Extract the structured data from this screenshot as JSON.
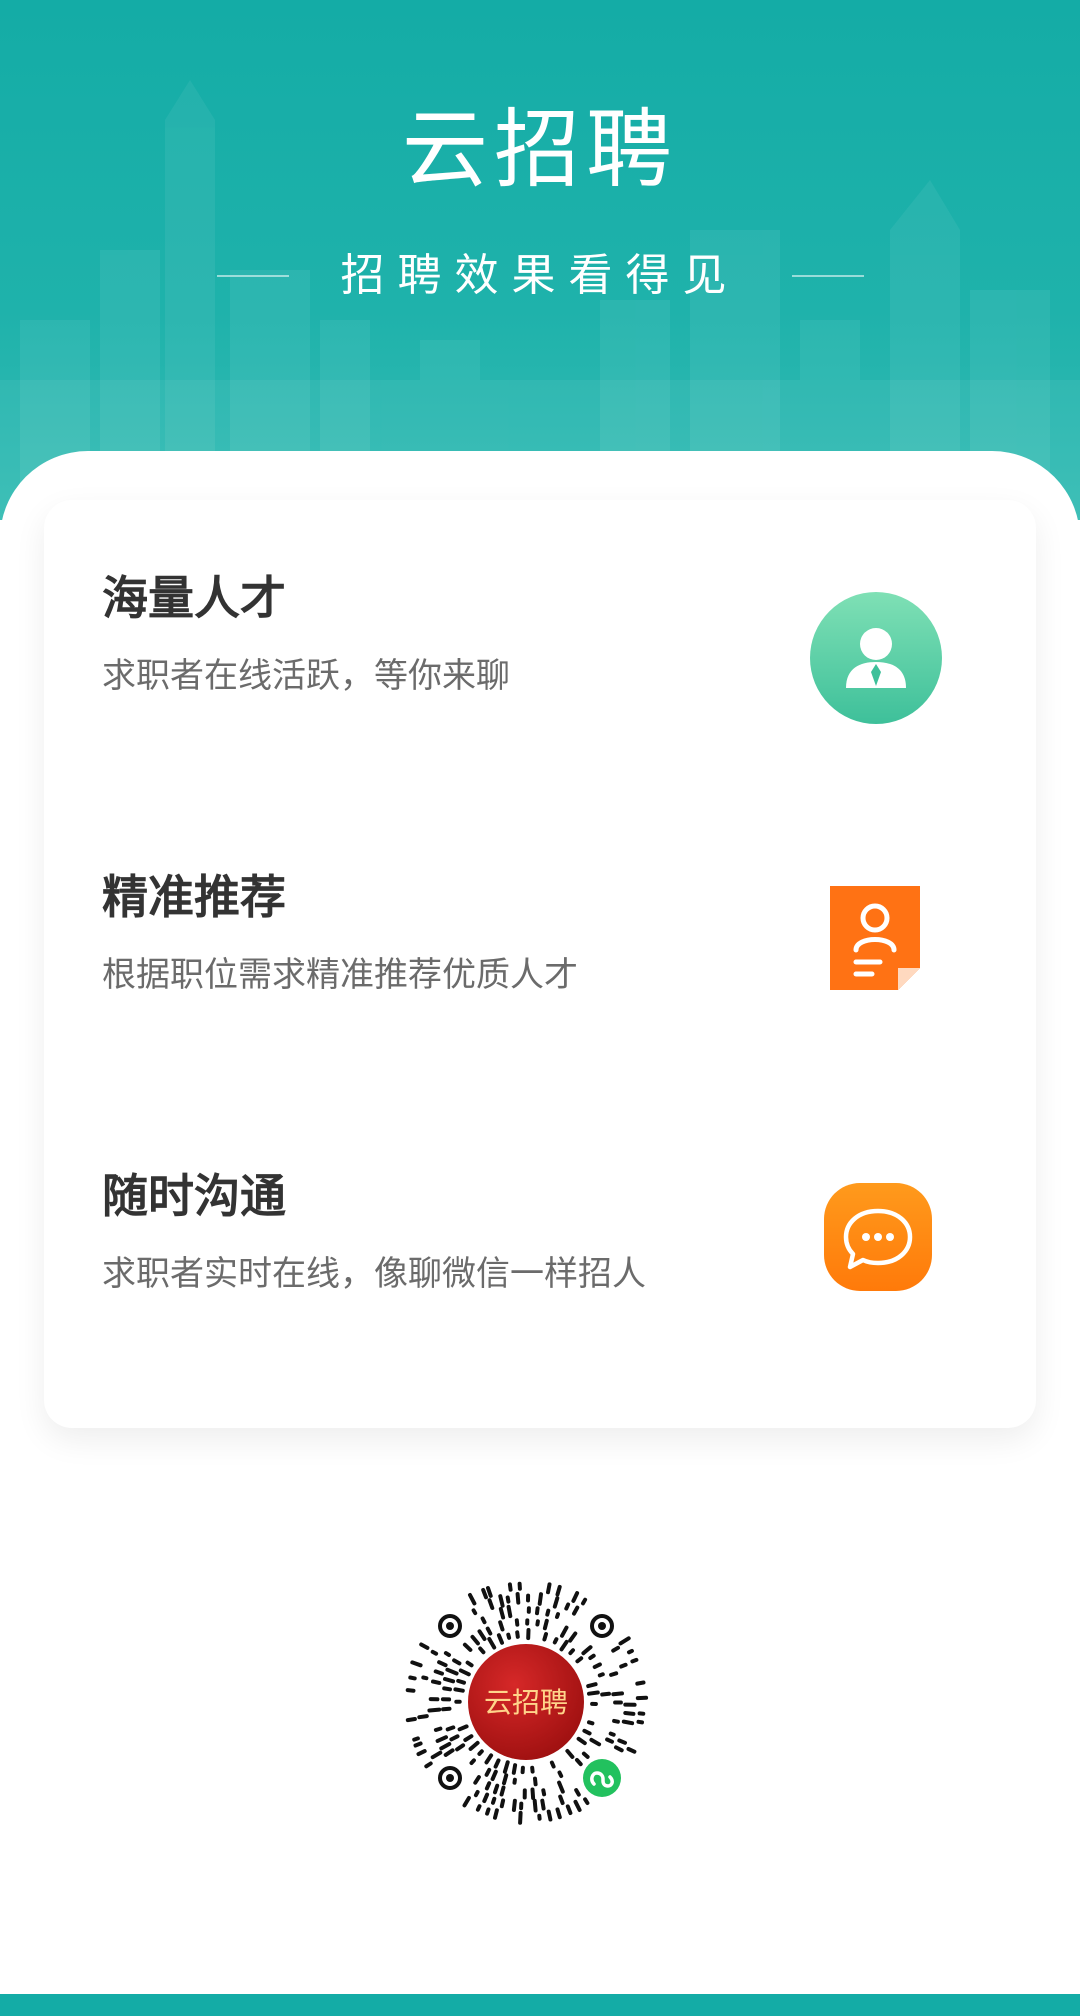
{
  "header": {
    "logo_text": "云招聘",
    "slogan": "招聘效果看得见"
  },
  "features": [
    {
      "title": "海量人才",
      "description": "求职者在线活跃，等你来聊",
      "icon": "talent-user-icon",
      "icon_color": "#52c9a0"
    },
    {
      "title": "精准推荐",
      "description": "根据职位需求精准推荐优质人才",
      "icon": "resume-document-icon",
      "icon_color": "#ff7a12"
    },
    {
      "title": "随时沟通",
      "description": "求职者实时在线，像聊微信一样招人",
      "icon": "chat-bubble-icon",
      "icon_color": "#ff8a10"
    }
  ],
  "qr_code": {
    "logo_text": "云招聘",
    "badge": "mini-program-icon"
  },
  "colors": {
    "brand_teal": "#14aca6",
    "green_icon": "#52c9a0",
    "orange_icon": "#ff7a12",
    "qr_red": "#b51a1a"
  }
}
